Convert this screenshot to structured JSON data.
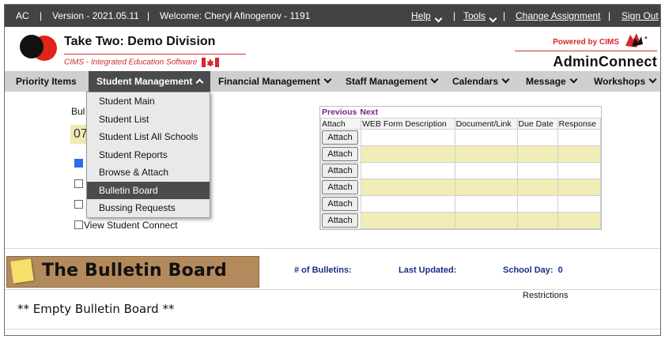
{
  "topbar": {
    "ac": "AC",
    "sep": "|",
    "version": "Version - 2021.05.11",
    "welcome": "Welcome: Cheryl Afinogenov - 1191",
    "help": "Help",
    "tools": "Tools",
    "change_assignment": "Change Assignment",
    "sign_out": "Sign Out"
  },
  "header": {
    "title": "Take Two: Demo Division",
    "subtitle": "CIMS - Integrated Education Software",
    "powered_by": "Powered by CIMS",
    "product": "AdminConnect"
  },
  "nav": {
    "items": [
      {
        "label": "Priority Items"
      },
      {
        "label": "Student Management"
      },
      {
        "label": "Financial Management"
      },
      {
        "label": "Staff Management"
      },
      {
        "label": "Calendars"
      },
      {
        "label": "Message"
      },
      {
        "label": "Workshops"
      }
    ]
  },
  "dropdown": {
    "items": [
      {
        "label": "Student Main"
      },
      {
        "label": "Student List"
      },
      {
        "label": "Student List All Schools"
      },
      {
        "label": "Student Reports"
      },
      {
        "label": "Browse & Attach"
      },
      {
        "label": "Bulletin Board"
      },
      {
        "label": "Bussing Requests"
      }
    ]
  },
  "form": {
    "bul_fragment": "Bul",
    "box_fragment": "07",
    "view_student_connect": "View Student Connect"
  },
  "grid": {
    "previous": "Previous",
    "next": "Next",
    "headers": [
      "Attach",
      "WEB Form Description",
      "Document/Link",
      "Due Date",
      "Response"
    ],
    "attach_label": "Attach"
  },
  "bulletin": {
    "board_title": "The Bulletin Board",
    "num_label": "# of Bulletins:",
    "updated_label": "Last Updated:",
    "school_day_label": "School Day:",
    "school_day_value": "0",
    "restrictions": "Restrictions",
    "empty": "** Empty Bulletin Board **"
  },
  "colors": {
    "topbar": "#434345",
    "nav_bg": "#cfcfcf",
    "active": "#4b4b4d",
    "brand_red": "#d4282d",
    "row_yellow": "#f2ecb6",
    "stat_blue": "#1a2d86"
  }
}
